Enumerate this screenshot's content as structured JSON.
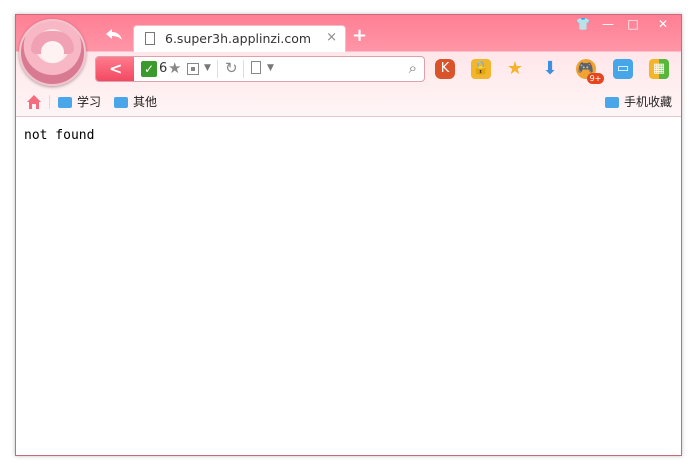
{
  "tab": {
    "title": "6.super3h.applinzi.com",
    "close": "×",
    "new": "+"
  },
  "window_controls": {
    "skin": "👕",
    "minimize": "—",
    "maximize": "□",
    "close": "✕"
  },
  "address": {
    "text": "6"
  },
  "toolbar": {
    "icons": [
      "kaspersky-icon",
      "lock-icon",
      "favorite-star-icon",
      "download-icon",
      "game-icon",
      "tv-icon",
      "apps-icon"
    ],
    "badge": "9+"
  },
  "bookmarks": {
    "items": [
      {
        "label": "学习",
        "icon": "folder-icon"
      },
      {
        "label": "其他",
        "icon": "folder-icon"
      }
    ],
    "mobile": "手机收藏"
  },
  "page": {
    "message": "not found"
  },
  "colors": {
    "accent": "#ff8a9d",
    "back": "#f24962",
    "check": "#3a9a2b",
    "folder": "#4aa5e9",
    "badge": "#e5451f"
  }
}
